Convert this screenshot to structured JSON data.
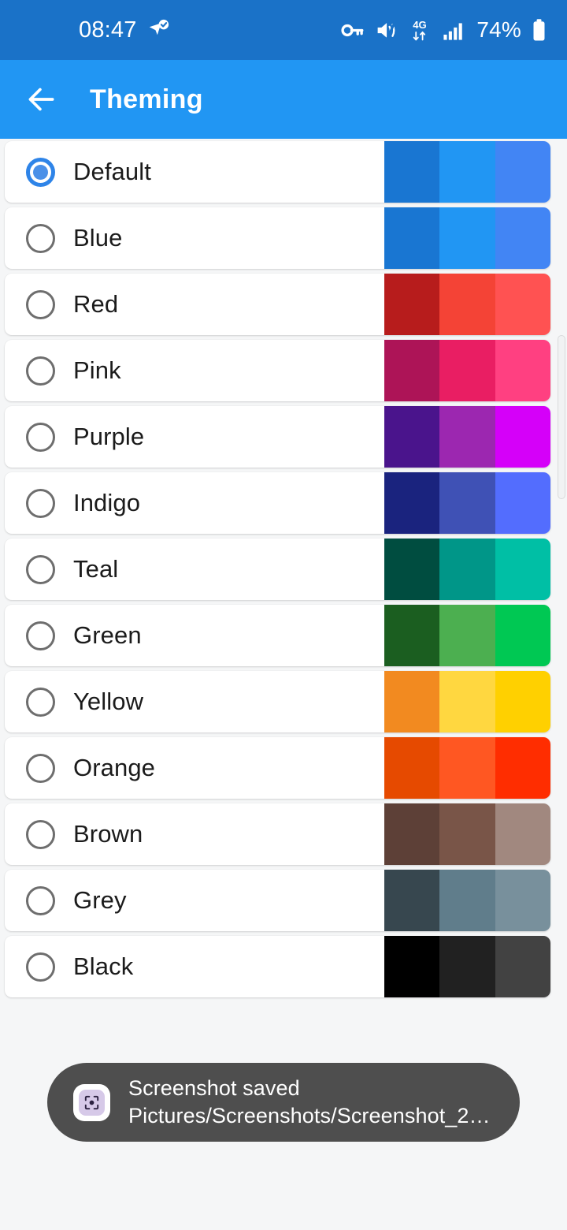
{
  "status_bar": {
    "time": "08:47",
    "battery_percent": "74%",
    "icons": [
      "location-pin-check-icon",
      "vpn-key-icon",
      "volume-mute-icon",
      "network-4g-icon",
      "signal-bars-icon",
      "battery-icon"
    ],
    "background_color": "#1a72c8",
    "foreground_color": "#ffffff"
  },
  "app_bar": {
    "title": "Theming",
    "back_icon": "back-arrow-icon",
    "background_color": "#2196f3",
    "text_color": "#ffffff"
  },
  "theme_list": {
    "selected": "Default",
    "items": [
      {
        "label": "Default",
        "selected": true,
        "swatches": [
          "#1976d2",
          "#2196f3",
          "#4285f4"
        ]
      },
      {
        "label": "Blue",
        "selected": false,
        "swatches": [
          "#1976d2",
          "#2196f3",
          "#4285f4"
        ]
      },
      {
        "label": "Red",
        "selected": false,
        "swatches": [
          "#b71c1c",
          "#f44336",
          "#ff5252"
        ]
      },
      {
        "label": "Pink",
        "selected": false,
        "swatches": [
          "#ad1457",
          "#e91e63",
          "#ff4081"
        ]
      },
      {
        "label": "Purple",
        "selected": false,
        "swatches": [
          "#4a148c",
          "#9c27b0",
          "#d500f9"
        ]
      },
      {
        "label": "Indigo",
        "selected": false,
        "swatches": [
          "#1a237e",
          "#3f51b5",
          "#536dfe"
        ]
      },
      {
        "label": "Teal",
        "selected": false,
        "swatches": [
          "#004d40",
          "#009688",
          "#00bfa5"
        ]
      },
      {
        "label": "Green",
        "selected": false,
        "swatches": [
          "#1b5e20",
          "#4caf50",
          "#00c853"
        ]
      },
      {
        "label": "Yellow",
        "selected": false,
        "swatches": [
          "#f28a20",
          "#ffd740",
          "#ffd000"
        ]
      },
      {
        "label": "Orange",
        "selected": false,
        "swatches": [
          "#e64a00",
          "#ff5722",
          "#ff2d00"
        ]
      },
      {
        "label": "Brown",
        "selected": false,
        "swatches": [
          "#5d4037",
          "#795548",
          "#a1887f"
        ]
      },
      {
        "label": "Grey",
        "selected": false,
        "swatches": [
          "#37474f",
          "#607d8b",
          "#78909c"
        ]
      },
      {
        "label": "Black",
        "selected": false,
        "swatches": [
          "#000000",
          "#212121",
          "#424242"
        ]
      }
    ]
  },
  "scrollbar": {
    "name": "vertical-scrollbar"
  },
  "toast": {
    "line1": "Screenshot saved",
    "line2": "Pictures/Screenshots/Screenshot_2…",
    "icon": "screenshot-app-icon",
    "background_color": "#4e4e4e"
  }
}
